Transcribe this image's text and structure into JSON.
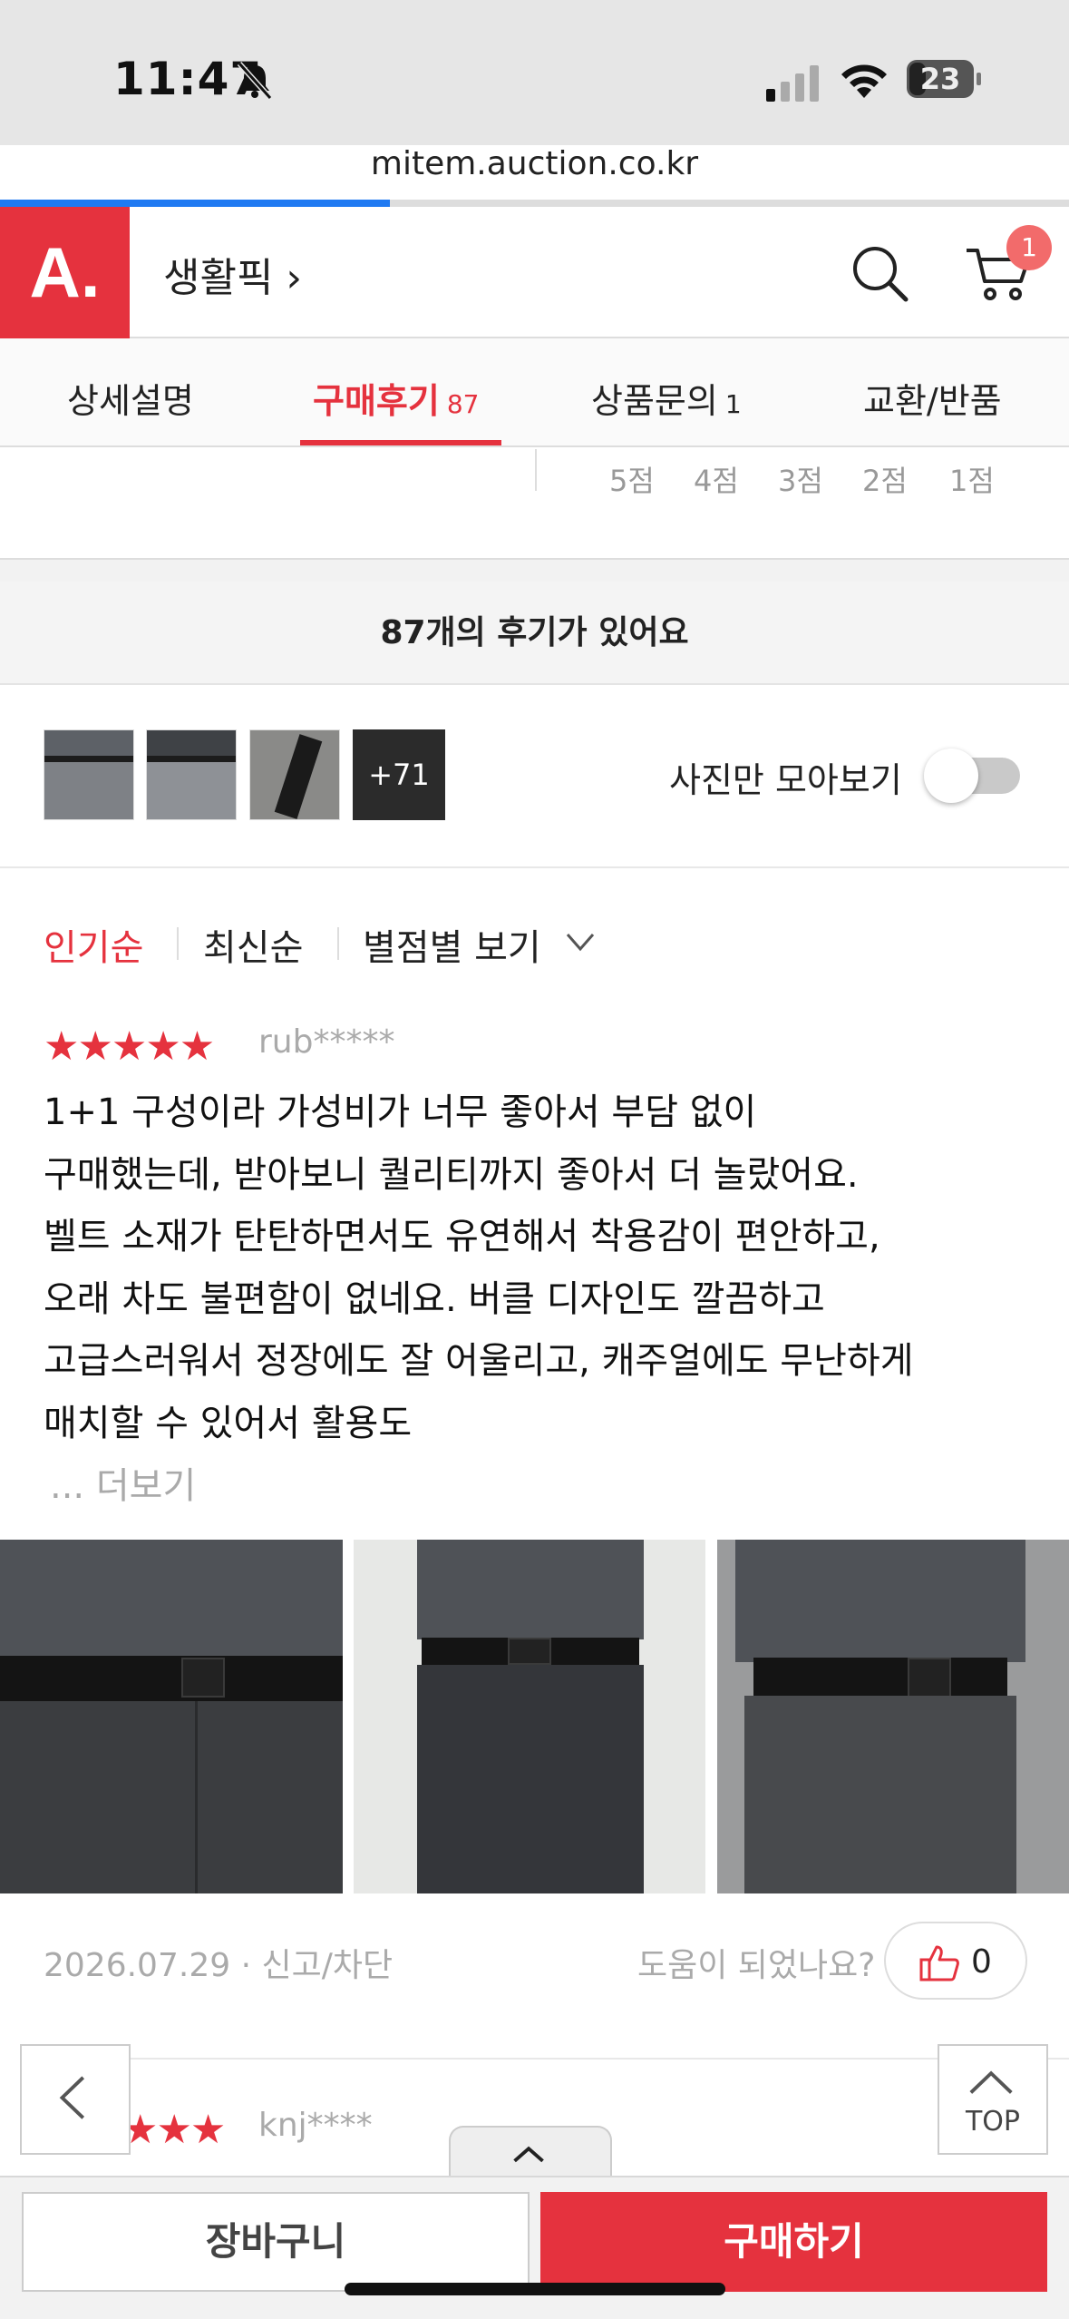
{
  "status": {
    "time": "11:47",
    "battery": "23"
  },
  "browser": {
    "url": "mitem.auction.co.kr"
  },
  "header": {
    "logo": "A.",
    "category": "생활픽 ›",
    "cart_count": "1"
  },
  "tabs": [
    {
      "label": "상세설명",
      "count": ""
    },
    {
      "label": "구매후기",
      "count": "87"
    },
    {
      "label": "상품문의",
      "count": "1"
    },
    {
      "label": "교환/반품",
      "count": ""
    }
  ],
  "rating_filters": [
    "5점",
    "4점",
    "3점",
    "2점",
    "1점"
  ],
  "review_count_text": "87개의 후기가 있어요",
  "photo_strip": {
    "more_label": "+71",
    "photo_only_label": "사진만 모아보기",
    "photo_only_on": false
  },
  "sort": {
    "popular": "인기순",
    "latest": "최신순",
    "by_rating": "별점별 보기"
  },
  "review1": {
    "stars": "★★★★★",
    "user": "rub*****",
    "lines": [
      "1+1 구성이라 가성비가 너무 좋아서 부담 없이",
      "구매했는데, 받아보니 퀄리티까지 좋아서 더 놀랐어요.",
      "벨트 소재가 탄탄하면서도 유연해서 착용감이 편안하고,",
      "오래 차도 불편함이 없네요. 버클 디자인도 깔끔하고",
      "고급스러워서 정장에도 잘 어울리고, 캐주얼에도 무난하게",
      "매치할 수 있어서 활용도"
    ],
    "more": "... 더보기",
    "date": "2026.07.29 · 신고/차단",
    "helpful_q": "도움이 되었나요?",
    "likes": "0"
  },
  "review2": {
    "stars": "★★★",
    "user": "knj****"
  },
  "buttons": {
    "top": "TOP",
    "cart": "장바구니",
    "buy": "구매하기"
  },
  "colors": {
    "accent": "#e5323e",
    "progress": "#1f7af2"
  }
}
